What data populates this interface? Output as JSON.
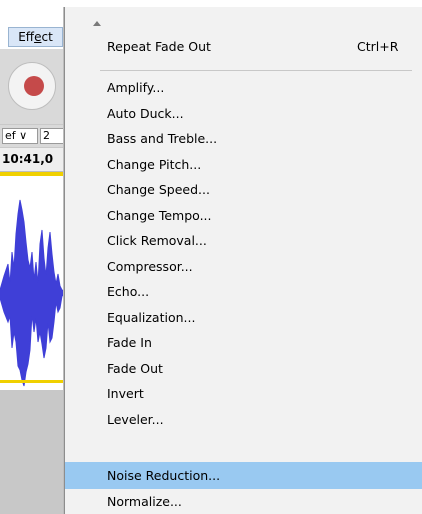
{
  "menubar": {
    "effect_label_prefix": "Eff",
    "effect_label_underlined": "e",
    "effect_label_suffix": "ct"
  },
  "toolbar": {
    "selector_left": "ef ∨",
    "selector_right": "2",
    "ruler_time": "10:41,0"
  },
  "menu": {
    "scroll_up_icon": "triangle-up-icon",
    "repeat": {
      "label": "Repeat Fade Out",
      "shortcut": "Ctrl+R"
    },
    "items": [
      "Amplify...",
      "Auto Duck...",
      "Bass and Treble...",
      "Change Pitch...",
      "Change Speed...",
      "Change Tempo...",
      "Click Removal...",
      "Compressor...",
      "Echo...",
      "Equalization...",
      "Fade In",
      "Fade Out",
      "Invert",
      "Leveler...",
      "Noise Reduction...",
      "Normalize..."
    ],
    "highlighted_item": "Noise Reduction..."
  },
  "colors": {
    "highlight": "#99c9f1",
    "waveform": "#3f3fd7",
    "record": "#c54a4a",
    "track_border": "#f0d000"
  }
}
